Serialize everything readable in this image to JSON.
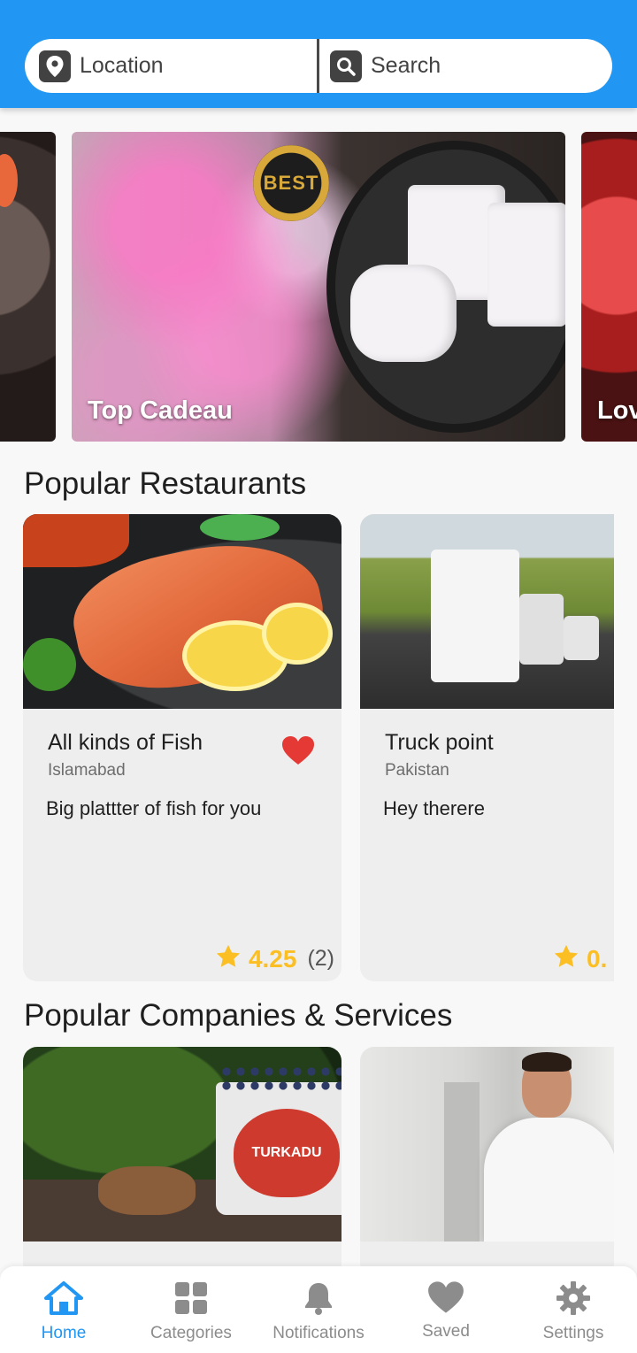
{
  "colors": {
    "primary": "#2196f3",
    "rating": "#fbbf24",
    "favorite": "#e53935",
    "inactive": "#8c8c8c"
  },
  "search": {
    "location_label": "Location",
    "search_label": "Search",
    "location_icon": "map-pin-icon",
    "search_icon": "magnifier-icon"
  },
  "banners": [
    {
      "title": ""
    },
    {
      "title": "Top Cadeau",
      "badge": "BEST"
    },
    {
      "title": "Lov"
    }
  ],
  "restaurants": {
    "heading": "Popular Restaurants",
    "items": [
      {
        "name": "All kinds of Fish",
        "city": "Islamabad",
        "description": "Big plattter of fish for you",
        "rating": "4.25",
        "count": "(2)",
        "favorite": true
      },
      {
        "name": "Truck point",
        "city": "Pakistan",
        "description": "Hey therere",
        "rating": "0."
      }
    ]
  },
  "companies": {
    "heading": "Popular Companies & Services",
    "items": [
      {
        "image_text": "TURKADU"
      },
      {
        "image_text": ""
      }
    ]
  },
  "nav": {
    "items": [
      {
        "label": "Home",
        "icon": "home-icon",
        "active": true
      },
      {
        "label": "Categories",
        "icon": "grid-icon"
      },
      {
        "label": "Notifications",
        "icon": "bell-icon"
      },
      {
        "label": "Saved",
        "icon": "heart-icon"
      },
      {
        "label": "Settings",
        "icon": "gear-icon"
      }
    ]
  }
}
